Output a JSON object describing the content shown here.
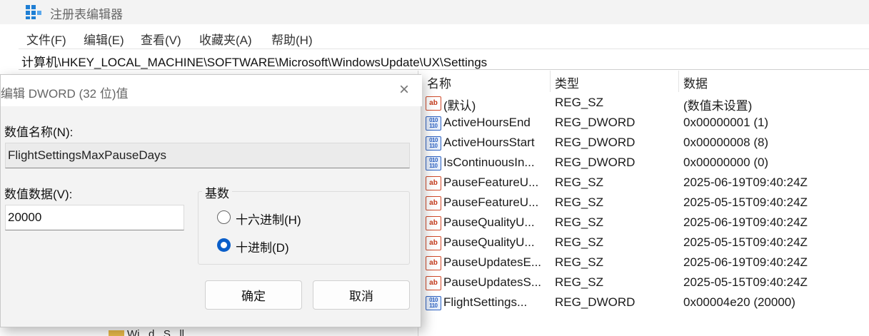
{
  "window": {
    "title": "注册表编辑器",
    "icon": "registry-editor-icon"
  },
  "menu": [
    "文件(F)",
    "编辑(E)",
    "查看(V)",
    "收藏夹(A)",
    "帮助(H)"
  ],
  "address": "计算机\\HKEY_LOCAL_MACHINE\\SOFTWARE\\Microsoft\\WindowsUpdate\\UX\\Settings",
  "tree": {
    "peek_text": "Wi...d...S...ll"
  },
  "list": {
    "headers": {
      "name": "名称",
      "type": "类型",
      "data": "数据"
    },
    "rows": [
      {
        "icon": "string-value-icon",
        "name": "(默认)",
        "type": "REG_SZ",
        "data": "(数值未设置)"
      },
      {
        "icon": "binary-value-icon",
        "name": "ActiveHoursEnd",
        "type": "REG_DWORD",
        "data": "0x00000001 (1)"
      },
      {
        "icon": "binary-value-icon",
        "name": "ActiveHoursStart",
        "type": "REG_DWORD",
        "data": "0x00000008 (8)"
      },
      {
        "icon": "binary-value-icon",
        "name": "IsContinuousIn...",
        "type": "REG_DWORD",
        "data": "0x00000000 (0)"
      },
      {
        "icon": "string-value-icon",
        "name": "PauseFeatureU...",
        "type": "REG_SZ",
        "data": "2025-06-19T09:40:24Z"
      },
      {
        "icon": "string-value-icon",
        "name": "PauseFeatureU...",
        "type": "REG_SZ",
        "data": "2025-05-15T09:40:24Z"
      },
      {
        "icon": "string-value-icon",
        "name": "PauseQualityU...",
        "type": "REG_SZ",
        "data": "2025-06-19T09:40:24Z"
      },
      {
        "icon": "string-value-icon",
        "name": "PauseQualityU...",
        "type": "REG_SZ",
        "data": "2025-05-15T09:40:24Z"
      },
      {
        "icon": "string-value-icon",
        "name": "PauseUpdatesE...",
        "type": "REG_SZ",
        "data": "2025-06-19T09:40:24Z"
      },
      {
        "icon": "string-value-icon",
        "name": "PauseUpdatesS...",
        "type": "REG_SZ",
        "data": "2025-05-15T09:40:24Z"
      },
      {
        "icon": "binary-value-icon",
        "name": "FlightSettings...",
        "type": "REG_DWORD",
        "data": "0x00004e20 (20000)"
      }
    ]
  },
  "dialog": {
    "title": "编辑 DWORD (32 位)值",
    "name_label": "数值名称(N):",
    "name_value": "FlightSettingsMaxPauseDays",
    "data_label": "数值数据(V):",
    "data_value": "20000",
    "base_label": "基数",
    "hex_label": "十六进制(H)",
    "dec_label": "十进制(D)",
    "selected_base": "dec",
    "ok_label": "确定",
    "cancel_label": "取消"
  },
  "colors": {
    "accent": "#0a5ec9",
    "string_icon": "#c5391a",
    "dword_icon": "#2f63c2"
  }
}
